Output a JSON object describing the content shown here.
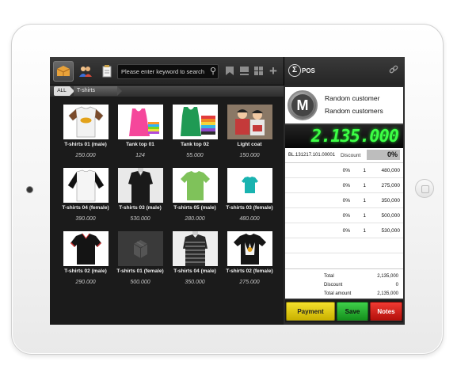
{
  "app": {
    "brand": "POS",
    "logo_glyph": "Σ"
  },
  "toolbar": {
    "search_placeholder": "Please enter keyword to search",
    "icons": [
      "box-icon",
      "users-icon",
      "notepad-icon",
      "bookmark-icon",
      "list-icon",
      "grid-icon",
      "plus-icon"
    ]
  },
  "breadcrumb": {
    "all_label": "ALL",
    "category_label": "T-shirts"
  },
  "products": [
    {
      "name": "T-shirts 01 (male)",
      "price": "250.000",
      "image": "white-tshirt"
    },
    {
      "name": "Tank top 01",
      "price": "124",
      "image": "pink-tank-top"
    },
    {
      "name": "Tank top 02",
      "price": "55.000",
      "image": "green-tank-top"
    },
    {
      "name": "Light coat",
      "price": "150.000",
      "image": "kids-photo"
    },
    {
      "name": "T-shirts 04 (female)",
      "price": "390.000",
      "image": "black-white-raglan"
    },
    {
      "name": "T-shirts 03 (male)",
      "price": "530.000",
      "image": "black-polo-mannequin"
    },
    {
      "name": "T-shirts 05 (male)",
      "price": "280.000",
      "image": "green-tshirt"
    },
    {
      "name": "T-shirts 03 (female)",
      "price": "480.000",
      "image": "teal-tshirt"
    },
    {
      "name": "T-shirts 02 (male)",
      "price": "290.000",
      "image": "black-polo"
    },
    {
      "name": "T-shirts 01 (female)",
      "price": "500.000",
      "image": "placeholder-box"
    },
    {
      "name": "T-shirts 04 (male)",
      "price": "350.000",
      "image": "striped-mannequin"
    },
    {
      "name": "T-shirts 02 (female)",
      "price": "275.000",
      "image": "black-print-tshirt"
    }
  ],
  "customer": {
    "avatar_letter": "M",
    "name": "Random customer",
    "group": "Random customers"
  },
  "total_display": "2.135.000",
  "bill": {
    "number": "BL.131217.101.00001",
    "discount_label": "Discount",
    "discount_value": "0%",
    "lines": [
      {
        "discount": "0%",
        "qty": "1",
        "amount": "480,000"
      },
      {
        "discount": "0%",
        "qty": "1",
        "amount": "275,000"
      },
      {
        "discount": "0%",
        "qty": "1",
        "amount": "350,000"
      },
      {
        "discount": "0%",
        "qty": "1",
        "amount": "500,000"
      },
      {
        "discount": "0%",
        "qty": "1",
        "amount": "530,000"
      }
    ],
    "summary": {
      "total_label": "Total",
      "total_value": "2,135,000",
      "discount_label": "Discount",
      "discount_value": "0",
      "total_amount_label": "Total amount",
      "total_amount_value": "2,135,000"
    }
  },
  "actions": {
    "payment": "Payment",
    "save": "Save",
    "notes": "Notes"
  },
  "colors": {
    "display_green": "#3cff45",
    "payment_yellow": "#f4e02c",
    "save_green": "#3fcf4a",
    "notes_red": "#f03a32"
  }
}
